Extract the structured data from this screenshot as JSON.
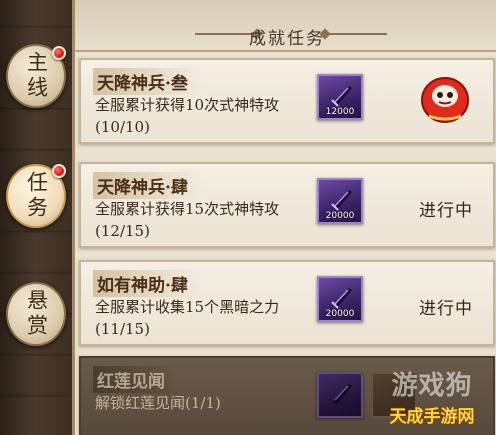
{
  "sidebar": {
    "tabs": [
      {
        "label": "主线",
        "has_notification": true,
        "active": false
      },
      {
        "label": "任务",
        "has_notification": true,
        "active": true
      },
      {
        "label": "悬赏",
        "has_notification": false,
        "active": false
      }
    ]
  },
  "panel": {
    "title": "成就任务"
  },
  "tasks": [
    {
      "title": "天降神兵·叁",
      "description": "全服累计获得10次式神特攻(10/10)",
      "reward_count": "12000",
      "reward_icon": "purple-blade-icon",
      "status": "",
      "claim_icon": "daruma-icon"
    },
    {
      "title": "天降神兵·肆",
      "description": "全服累计获得15次式神特攻(12/15)",
      "reward_count": "20000",
      "reward_icon": "purple-blade-icon",
      "status": "进行中"
    },
    {
      "title": "如有神助·肆",
      "description": "全服累计收集15个黑暗之力(11/15)",
      "reward_count": "20000",
      "reward_icon": "purple-blade-icon",
      "status": "进行中"
    },
    {
      "title": "红莲见闻",
      "description": "解锁红莲见闻(1/1)",
      "reward_count": "",
      "reward_icon": "purple-blade-icon",
      "status": "",
      "locked": true
    }
  ],
  "watermark": {
    "top": "游戏狗",
    "bottom": "天成手游网"
  },
  "colors": {
    "panel_bg": "#e9e1d2",
    "card_border": "#c6b494",
    "reward_purple": "#3b2266",
    "notification_red": "#e0221c",
    "watermark_gold": "#ffd34a"
  }
}
